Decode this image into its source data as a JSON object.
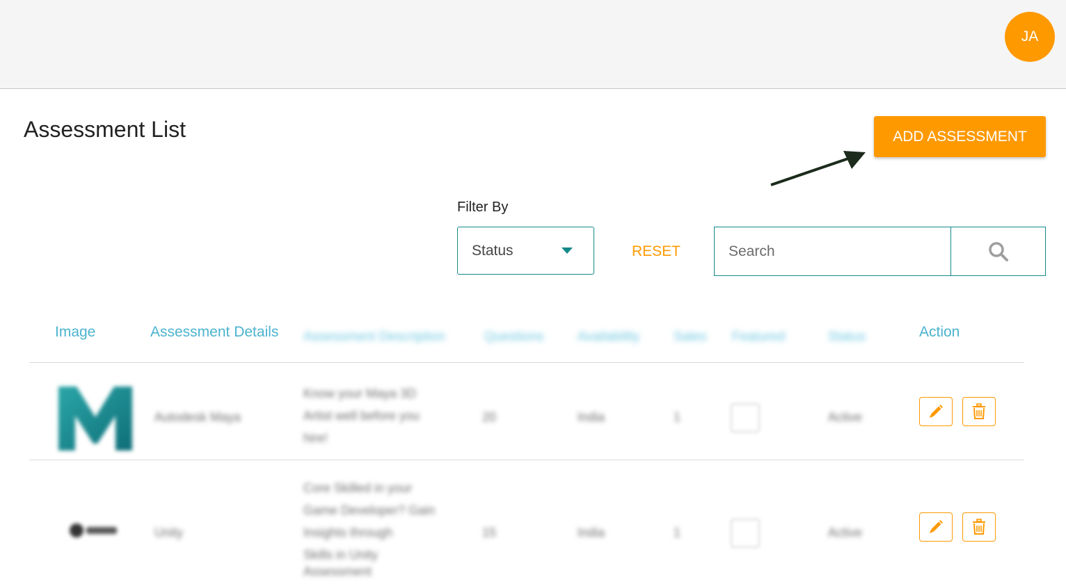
{
  "header": {
    "avatar_initials": "JA"
  },
  "page": {
    "title": "Assessment List",
    "add_button_label": "ADD ASSESSMENT"
  },
  "filters": {
    "filter_label": "Filter By",
    "status_value": "Status",
    "reset_label": "RESET",
    "search_placeholder": "Search"
  },
  "table": {
    "columns": [
      "Image",
      "Assessment Details",
      "Assessment Description",
      "Questions",
      "Availability",
      "Sales",
      "Featured",
      "Status",
      "Action"
    ],
    "rows": [
      {
        "details": "Autodesk Maya",
        "description": [
          "Know your Maya 3D",
          "Artist well before you",
          "hire!"
        ],
        "questions": "20",
        "availability": "India",
        "sales": "1",
        "status": "Active"
      },
      {
        "details": "Unity",
        "description": [
          "Core Skilled in your",
          "Game Developer? Gain",
          "Insights through",
          "Skills in Unity",
          "Assessment"
        ],
        "questions": "15",
        "availability": "India",
        "sales": "1",
        "status": "Active"
      }
    ]
  },
  "colors": {
    "accent_orange": "#ff9900",
    "teal_border": "#13888a",
    "header_blue": "#4bb3cf"
  }
}
